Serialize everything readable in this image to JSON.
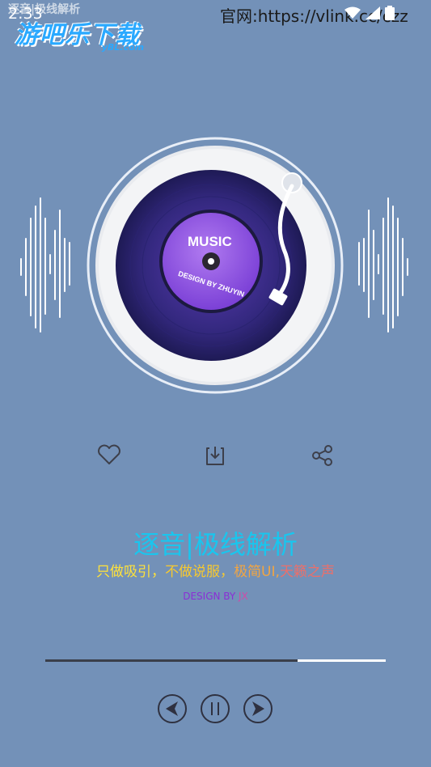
{
  "status_bar": {
    "time": "2:33",
    "app_name": "逐音|极线解析",
    "url": "官网:https://vlink.cc/czz"
  },
  "watermark": {
    "logo": "游吧乐下载",
    "domain": "yBL.com"
  },
  "record": {
    "label_title": "MUSIC",
    "label_sub": "DESIGN BY ZHUYIN"
  },
  "actions": {
    "like": "heart-icon",
    "download": "download-icon",
    "share": "share-icon"
  },
  "main": {
    "title": "逐音|极线解析",
    "slogan_parts": [
      "只做吸引，",
      "不做说服，",
      "极简UI,",
      "天籁之声"
    ],
    "design_prefix": "DESIGN BY ",
    "design_name": "JX"
  },
  "player": {
    "progress": 0.74,
    "prev": "prev-icon",
    "pause": "pause-icon",
    "next": "next-icon"
  },
  "colors": {
    "background": "#7391b8",
    "title": "#19c6ee",
    "vinyl": "#3a2d8c",
    "label": "#8a4be0"
  }
}
